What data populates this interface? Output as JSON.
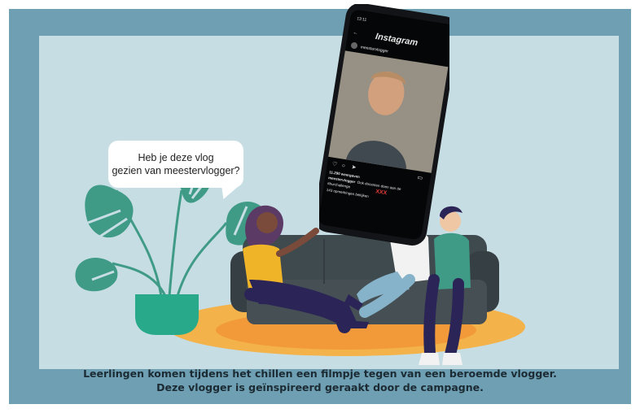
{
  "bubble": {
    "line1": "Heb je deze vlog",
    "line2": "gezien van meestervlogger?"
  },
  "phone": {
    "status_time": "13:11",
    "app_name": "Instagram",
    "username": "meestervlogger",
    "views": "11.290 weergaven",
    "caption_user": "meestervlogger",
    "caption_text": "Ook docenten doen aan de",
    "hashtag": "#burchallenge",
    "xxx": "XXX",
    "comments": "143 opmerkingen bekijken"
  },
  "caption": {
    "line1": "Leerlingen komen tijdens het chillen een filmpje tegen van een beroemde vlogger.",
    "line2": "Deze vlogger is geïnspireerd geraakt door de campagne."
  },
  "colors": {
    "frame": "#6e9fb3",
    "panel": "#c6dde4",
    "rug": "#f3b24a",
    "couch": "#3f4a4f",
    "plant": "#3f9a86",
    "pot": "#27a98a",
    "phone": "#121417"
  }
}
